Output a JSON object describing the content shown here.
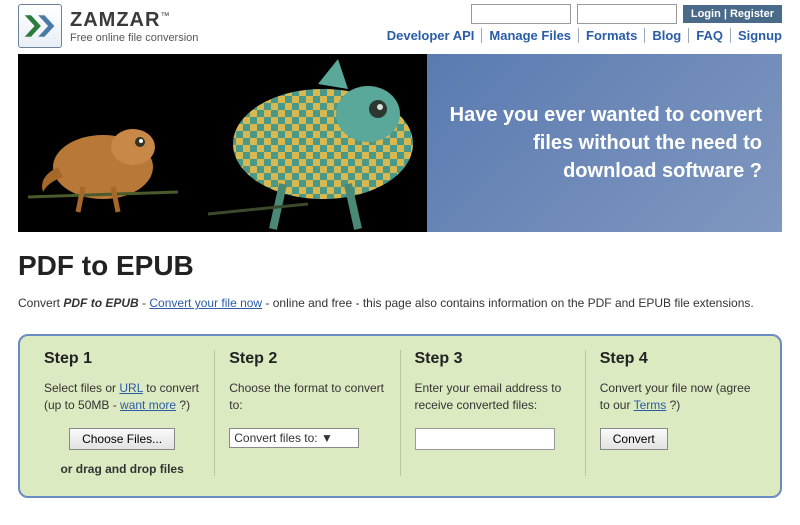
{
  "brand": {
    "name": "ZAMZAR",
    "tm": "™",
    "tagline": "Free online file conversion"
  },
  "auth": {
    "login_register": "Login  |  Register"
  },
  "nav": {
    "dev": "Developer API",
    "manage": "Manage Files",
    "formats": "Formats",
    "blog": "Blog",
    "faq": "FAQ",
    "signup": "Signup"
  },
  "hero": {
    "text": "Have you ever wanted to convert files without the need to download software ?"
  },
  "page": {
    "title": "PDF to EPUB",
    "desc_prefix": "Convert ",
    "desc_em": "PDF to EPUB",
    "desc_dash": " - ",
    "desc_link": "Convert your file now",
    "desc_suffix": " - online and free - this page also contains information on the PDF and EPUB file extensions."
  },
  "steps": {
    "s1": {
      "title": "Step 1",
      "text_a": "Select files or ",
      "url": "URL",
      "text_b": " to convert (up to 50MB - ",
      "want_more": "want more",
      "text_c": " ?)",
      "choose": "Choose Files...",
      "drag": "or drag and drop files"
    },
    "s2": {
      "title": "Step 2",
      "text": "Choose the format to convert to:",
      "select_label": "Convert files to:  ▼"
    },
    "s3": {
      "title": "Step 3",
      "text": "Enter your email address to receive converted files:"
    },
    "s4": {
      "title": "Step 4",
      "text_a": "Convert your file now (agree to our ",
      "terms": "Terms",
      "text_b": " ?)",
      "convert": "Convert"
    }
  }
}
